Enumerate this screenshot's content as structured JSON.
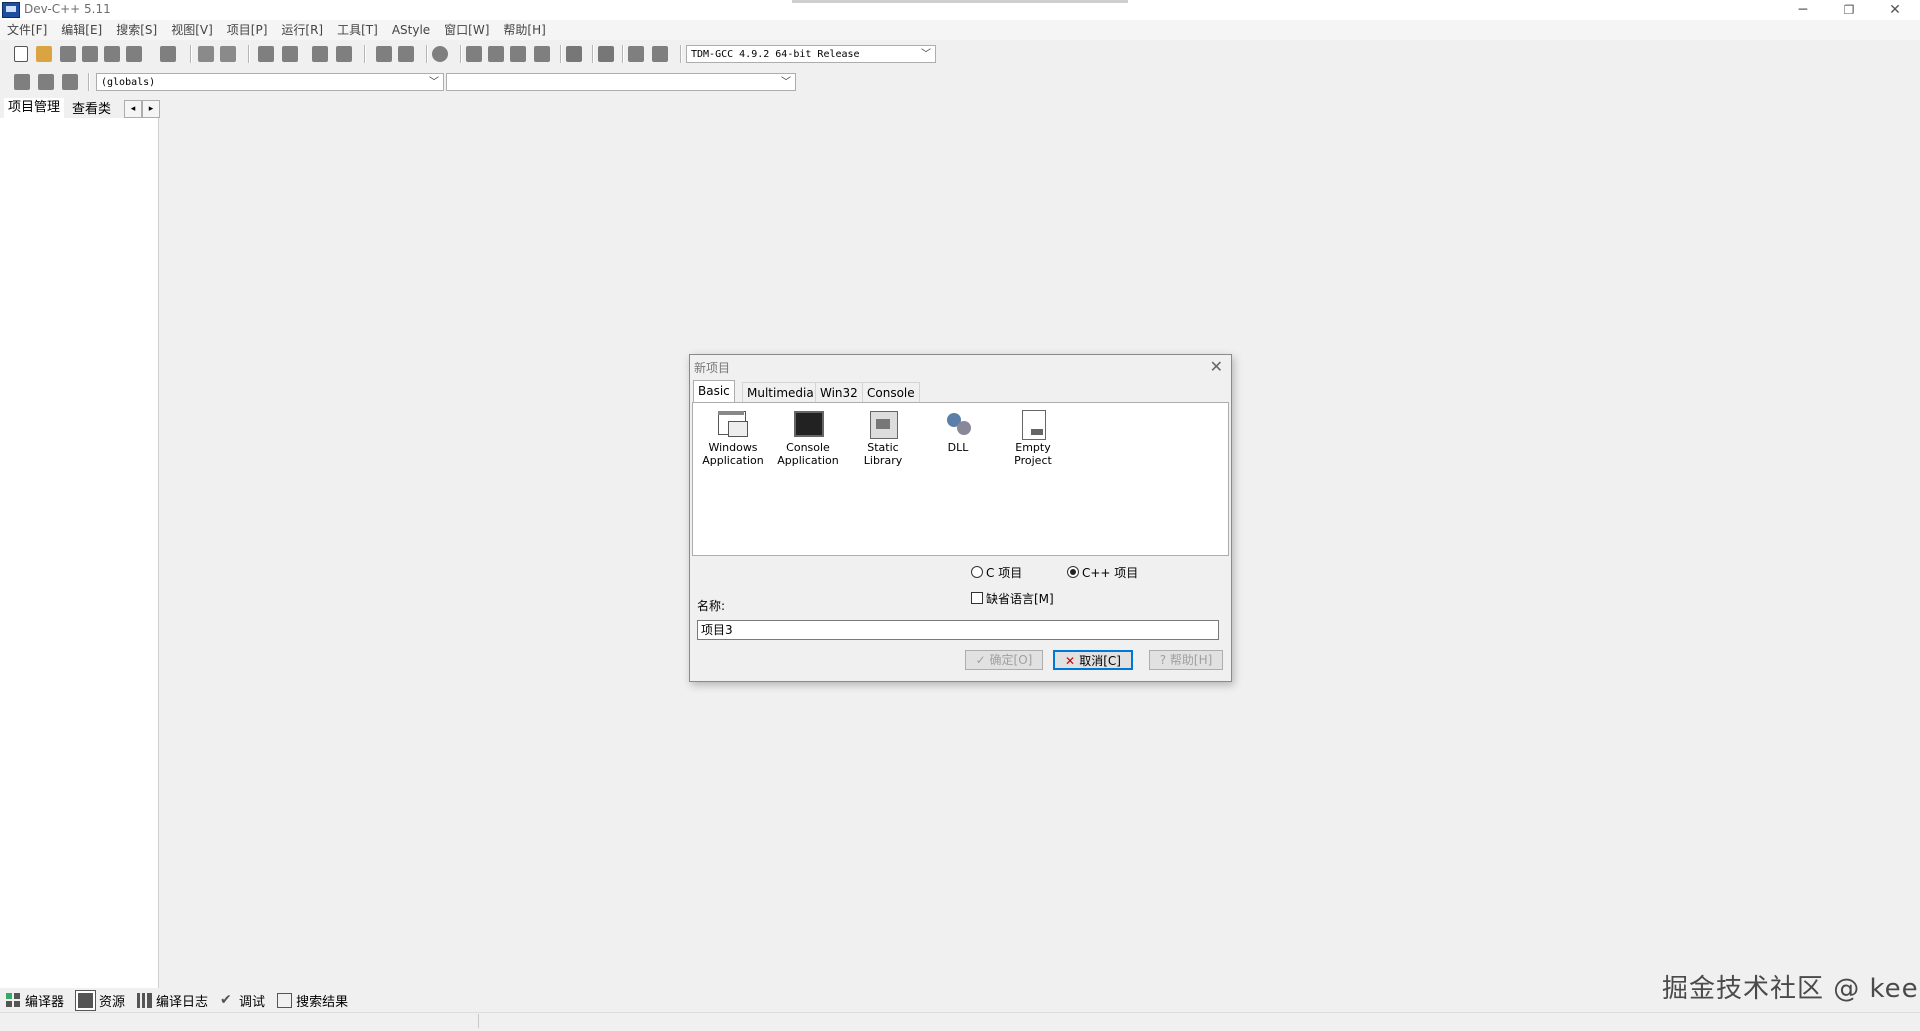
{
  "window": {
    "title": "Dev-C++ 5.11",
    "minimize": "─",
    "restore": "❐",
    "close": "✕"
  },
  "menu": [
    "文件[F]",
    "编辑[E]",
    "搜索[S]",
    "视图[V]",
    "项目[P]",
    "运行[R]",
    "工具[T]",
    "AStyle",
    "窗口[W]",
    "帮助[H]"
  ],
  "toolbar": {
    "compiler_select": "TDM-GCC 4.9.2 64-bit Release",
    "globals_select": "(globals)",
    "member_select": ""
  },
  "left_panel": {
    "tabs": [
      "项目管理",
      "查看类"
    ]
  },
  "bottom_tabs": [
    "编译器",
    "资源",
    "编译日志",
    "调试",
    "搜索结果"
  ],
  "watermark": "掘金技术社区 @ kee",
  "dialog": {
    "title": "新项目",
    "tabs": [
      "Basic",
      "Multimedia",
      "Win32",
      "Console"
    ],
    "projects": [
      {
        "label": "Windows Application",
        "icon": "windows-app-icon"
      },
      {
        "label": "Console Application",
        "icon": "console-app-icon"
      },
      {
        "label": "Static Library",
        "icon": "static-library-icon"
      },
      {
        "label": "DLL",
        "icon": "dll-icon"
      },
      {
        "label": "Empty Project",
        "icon": "empty-project-icon"
      }
    ],
    "radio_c": "C 项目",
    "radio_cpp": "C++ 项目",
    "default_lang": "缺省语言[M]",
    "name_label": "名称:",
    "name_value": "项目3",
    "ok_label": "确定[O]",
    "cancel_label": "取消[C]",
    "help_label": "帮助[H]"
  }
}
